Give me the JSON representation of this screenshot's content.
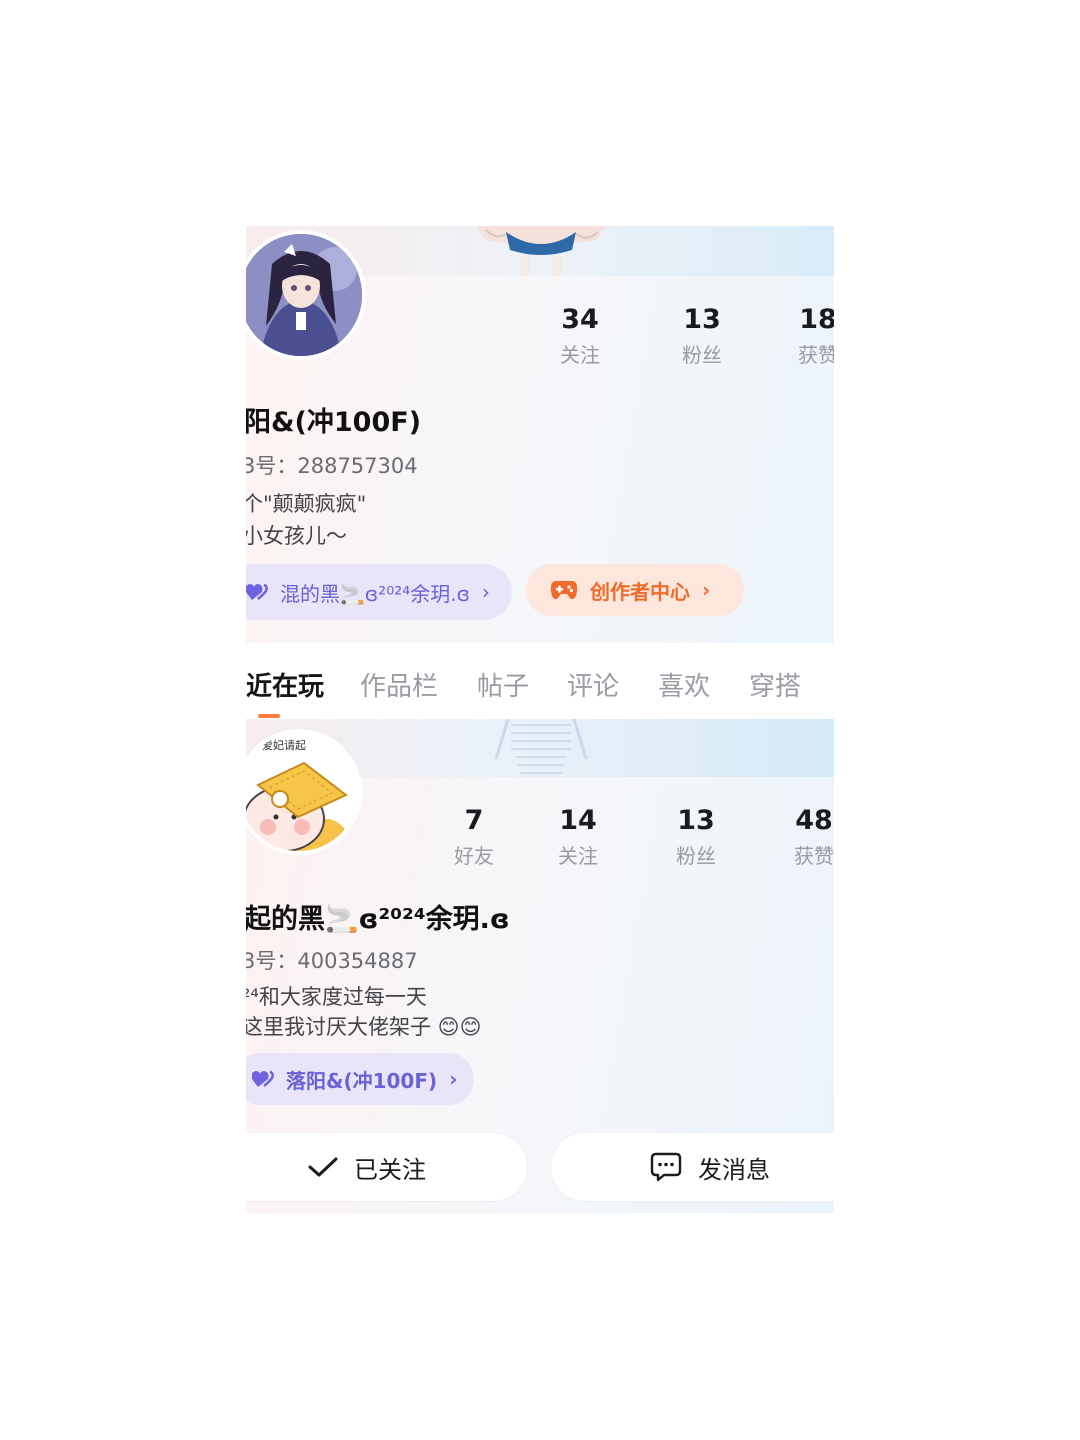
{
  "profile_top": {
    "name": "阳&(冲100F)",
    "uid": "3号：288757304",
    "bio": [
      "个\"颠颠疯疯\"",
      "小女孩儿～"
    ],
    "stats": [
      {
        "num": "34",
        "label": "关注"
      },
      {
        "num": "13",
        "label": "粉丝"
      },
      {
        "num": "18",
        "label": "获赞"
      }
    ],
    "couple_pill": "混的黑🚬ɞ²⁰²⁴余玥.ɞ",
    "creator_pill": "创作者中心"
  },
  "tabs": [
    {
      "label": "近在玩",
      "active": true
    },
    {
      "label": "作品栏",
      "active": false
    },
    {
      "label": "帖子",
      "active": false
    },
    {
      "label": "评论",
      "active": false
    },
    {
      "label": "喜欢",
      "active": false
    },
    {
      "label": "穿搭",
      "active": false
    }
  ],
  "profile_bottom": {
    "avatar_caption": "爱妃请起",
    "name": "起的黑🚬ɞ²⁰²⁴余玥.ɞ",
    "uid": "3号：400354887",
    "bio": [
      "²⁴和大家度过每一天",
      "这里我讨厌大佬架子 😊😊"
    ],
    "stats": [
      {
        "num": "7",
        "label": "好友"
      },
      {
        "num": "14",
        "label": "关注"
      },
      {
        "num": "13",
        "label": "粉丝"
      },
      {
        "num": "48",
        "label": "获赞"
      }
    ],
    "couple_pill": "落阳&(冲100F)",
    "follow_button": "已关注",
    "message_button": "发消息"
  },
  "colors": {
    "accent_orange": "#f06b2b",
    "couple_purple": "#6a62d6",
    "muted_text": "#9a9aa3"
  },
  "chevron": "›"
}
